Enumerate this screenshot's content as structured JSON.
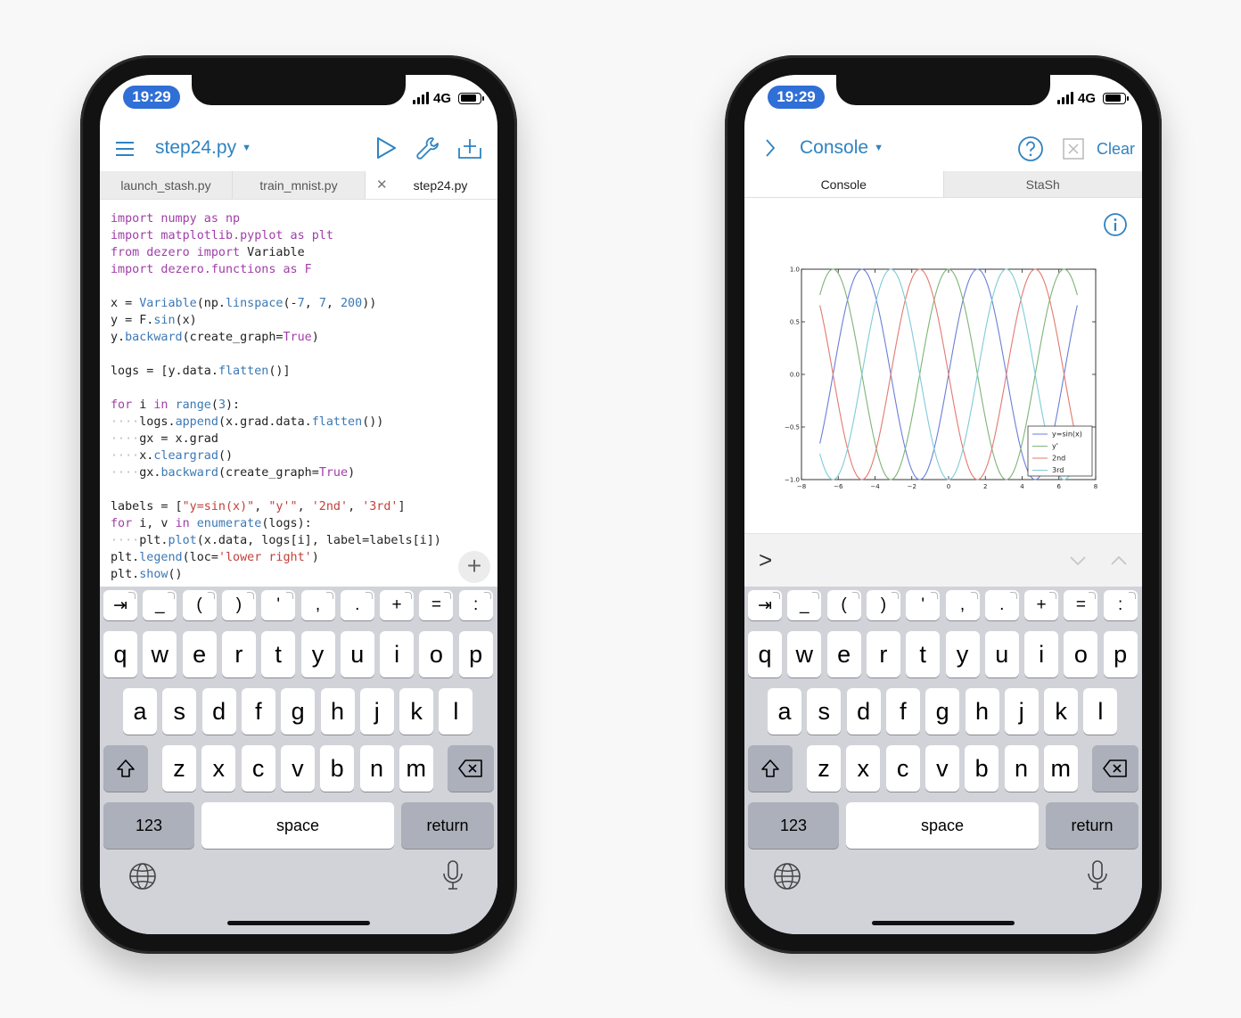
{
  "left": {
    "status": {
      "time": "19:29",
      "network": "4G"
    },
    "nav": {
      "title": "step24.py"
    },
    "tabs": [
      {
        "label": "launch_stash.py"
      },
      {
        "label": "train_mnist.py"
      },
      {
        "label": "step24.py",
        "active": true
      }
    ],
    "code_lines": [
      [
        [
          "kw",
          "import numpy as np"
        ]
      ],
      [
        [
          "kw",
          "import matplotlib.pyplot as plt"
        ]
      ],
      [
        [
          "kw",
          "from dezero "
        ],
        [
          "kw",
          "import"
        ],
        [
          "t",
          " Variable"
        ]
      ],
      [
        [
          "kw",
          "import dezero.functions as F"
        ]
      ],
      [],
      [
        [
          "t",
          "x = "
        ],
        [
          "fn",
          "Variable"
        ],
        [
          "t",
          "(np."
        ],
        [
          "fn",
          "linspace"
        ],
        [
          "t",
          "(-"
        ],
        [
          "num",
          "7"
        ],
        [
          "t",
          ", "
        ],
        [
          "num",
          "7"
        ],
        [
          "t",
          ", "
        ],
        [
          "num",
          "200"
        ],
        [
          "t",
          "))"
        ]
      ],
      [
        [
          "t",
          "y = F."
        ],
        [
          "fn",
          "sin"
        ],
        [
          "t",
          "(x)"
        ]
      ],
      [
        [
          "t",
          "y."
        ],
        [
          "fn",
          "backward"
        ],
        [
          "t",
          "(create_graph="
        ],
        [
          "kw",
          "True"
        ],
        [
          "t",
          ")"
        ]
      ],
      [],
      [
        [
          "t",
          "logs = [y.data."
        ],
        [
          "fn",
          "flatten"
        ],
        [
          "t",
          "()]"
        ]
      ],
      [],
      [
        [
          "kw",
          "for"
        ],
        [
          "t",
          " i "
        ],
        [
          "kw",
          "in"
        ],
        [
          "t",
          " "
        ],
        [
          "fn",
          "range"
        ],
        [
          "t",
          "("
        ],
        [
          "num",
          "3"
        ],
        [
          "t",
          "):"
        ]
      ],
      [
        [
          "d",
          "····"
        ],
        [
          "t",
          "logs."
        ],
        [
          "fn",
          "append"
        ],
        [
          "t",
          "(x.grad.data."
        ],
        [
          "fn",
          "flatten"
        ],
        [
          "t",
          "())"
        ]
      ],
      [
        [
          "d",
          "····"
        ],
        [
          "t",
          "gx = x.grad"
        ]
      ],
      [
        [
          "d",
          "····"
        ],
        [
          "t",
          "x."
        ],
        [
          "fn",
          "cleargrad"
        ],
        [
          "t",
          "()"
        ]
      ],
      [
        [
          "d",
          "····"
        ],
        [
          "t",
          "gx."
        ],
        [
          "fn",
          "backward"
        ],
        [
          "t",
          "(create_graph="
        ],
        [
          "kw",
          "True"
        ],
        [
          "t",
          ")"
        ]
      ],
      [],
      [
        [
          "t",
          "labels = ["
        ],
        [
          "str",
          "\"y=sin(x)\""
        ],
        [
          "t",
          ", "
        ],
        [
          "str",
          "\"y'\""
        ],
        [
          "t",
          ", "
        ],
        [
          "str",
          "'2nd'"
        ],
        [
          "t",
          ", "
        ],
        [
          "str",
          "'3rd'"
        ],
        [
          "t",
          "]"
        ]
      ],
      [
        [
          "kw",
          "for"
        ],
        [
          "t",
          " i, v "
        ],
        [
          "kw",
          "in"
        ],
        [
          "t",
          " "
        ],
        [
          "fn",
          "enumerate"
        ],
        [
          "t",
          "(logs):"
        ]
      ],
      [
        [
          "d",
          "····"
        ],
        [
          "t",
          "plt."
        ],
        [
          "fn",
          "plot"
        ],
        [
          "t",
          "(x.data, logs[i], label=labels[i])"
        ]
      ],
      [
        [
          "t",
          "plt."
        ],
        [
          "fn",
          "legend"
        ],
        [
          "t",
          "(loc="
        ],
        [
          "str",
          "'lower right'"
        ],
        [
          "t",
          ")"
        ]
      ],
      [
        [
          "t",
          "plt."
        ],
        [
          "fn",
          "show"
        ],
        [
          "t",
          "()"
        ]
      ]
    ],
    "add_label": "+"
  },
  "right": {
    "status": {
      "time": "19:29",
      "network": "4G"
    },
    "nav": {
      "title": "Console",
      "clear": "Clear"
    },
    "tabs": [
      {
        "label": "Console",
        "active": true
      },
      {
        "label": "StaSh"
      }
    ],
    "prompt": ">"
  },
  "keyboard": {
    "symbols": [
      "⇥",
      "_",
      "(",
      ")",
      "'",
      ",",
      ".",
      "+",
      "=",
      ":"
    ],
    "row1": [
      "q",
      "w",
      "e",
      "r",
      "t",
      "y",
      "u",
      "i",
      "o",
      "p"
    ],
    "row2": [
      "a",
      "s",
      "d",
      "f",
      "g",
      "h",
      "j",
      "k",
      "l"
    ],
    "row3": [
      "z",
      "x",
      "c",
      "v",
      "b",
      "n",
      "m"
    ],
    "numbers": "123",
    "space": "space",
    "return": "return"
  },
  "chart_data": {
    "type": "line",
    "xlim": [
      -8,
      8
    ],
    "ylim": [
      -1.0,
      1.0
    ],
    "xticks": [
      -8,
      -6,
      -4,
      -2,
      0,
      2,
      4,
      6,
      8
    ],
    "yticks": [
      1.0,
      0.5,
      0.0,
      -0.5,
      -1.0
    ],
    "xtick_labels": [
      "−8",
      "−6",
      "−4",
      "−2",
      "0",
      "2",
      "4",
      "6",
      "8"
    ],
    "ytick_labels": [
      "1.0",
      "0.5",
      "0.0",
      "−0.5",
      "−1.0"
    ],
    "x_range_data": [
      -7,
      7
    ],
    "series": [
      {
        "name": "y=sin(x)",
        "function": "sin(x)",
        "color": "#6b7fd7"
      },
      {
        "name": "y'",
        "function": "cos(x)",
        "color": "#7fb477"
      },
      {
        "name": "2nd",
        "function": "-sin(x)",
        "color": "#e27a6f"
      },
      {
        "name": "3rd",
        "function": "-cos(x)",
        "color": "#7fcbd6"
      }
    ],
    "legend": "lower-right",
    "grid": false
  }
}
